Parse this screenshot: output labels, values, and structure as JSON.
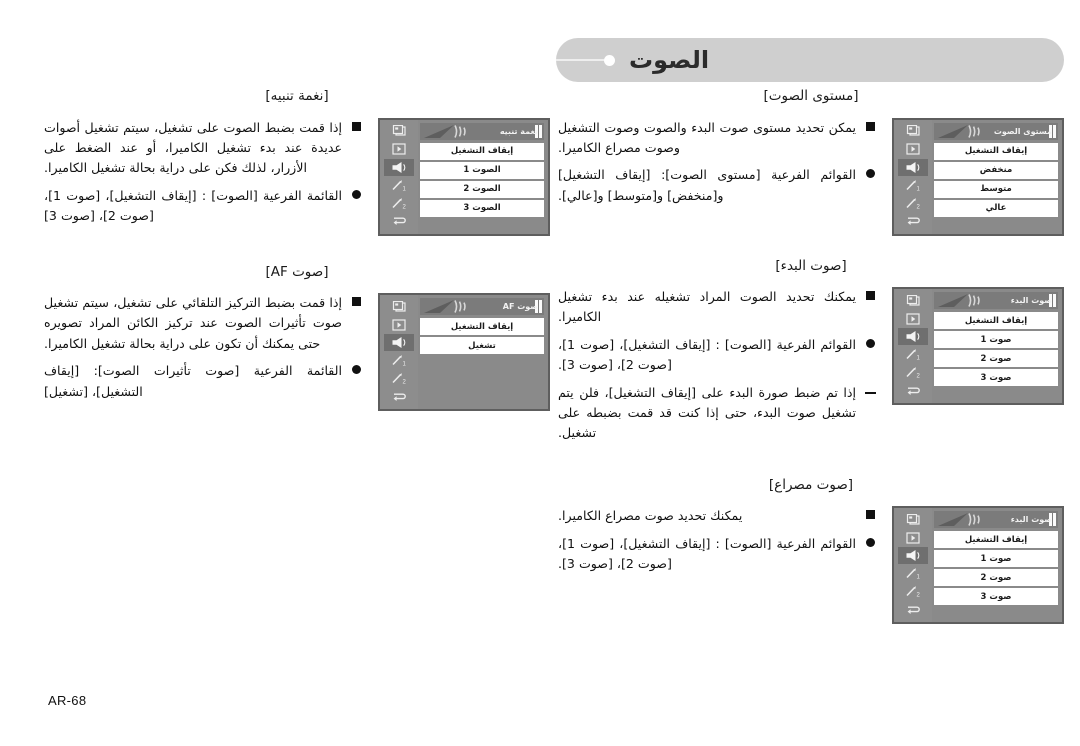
{
  "page": {
    "number_label": "AR-68",
    "header_title": "الصوت"
  },
  "sections": {
    "volume_level": {
      "title": "[مستوى الصوت]",
      "bullets": [
        "يمكن تحديد مستوى صوت البدء والصوت وصوت التشغيل وصوت مصراع الكاميرا.",
        "القوائم الفرعية [مستوى الصوت]: [إيقاف التشغيل] و[منخفض] و[متوسط] و[عالي]."
      ],
      "menu": {
        "header": "مستوى الصوت",
        "items": [
          "إيقاف التشغيل",
          "منخفض",
          "متوسط",
          "عالي"
        ]
      }
    },
    "start_sound": {
      "title": "[صوت البدء]",
      "bullets": [
        "يمكنك تحديد الصوت المراد تشغيله عند بدء تشغيل الكاميرا.",
        "القوائم الفرعية [الصوت] : [إيقاف التشغيل]، [صوت 1]، [صوت 2]، [صوت 3].",
        "إذا تم ضبط صورة البدء على [إيقاف التشغيل]، فلن يتم تشغيل صوت البدء، حتى إذا كنت قد قمت بضبطه على تشغيل."
      ],
      "menu": {
        "header": "صوت البدء",
        "items": [
          "إيقاف التشغيل",
          "صوت 1",
          "صوت 2",
          "صوت 3"
        ]
      }
    },
    "shutter_sound": {
      "title": "[صوت مصراع]",
      "bullets": [
        "يمكنك تحديد صوت مصراع الكاميرا.",
        "القوائم الفرعية [الصوت] : [إيقاف التشغيل]، [صوت 1]، [صوت 2]، [صوت 3]."
      ],
      "menu": {
        "header": "صوت البدء",
        "items": [
          "إيقاف التشغيل",
          "صوت 1",
          "صوت 2",
          "صوت 3"
        ]
      }
    },
    "beep_sound": {
      "title": "[نغمة تنبيه]",
      "bullets": [
        "إذا قمت بضبط الصوت على تشغيل، سيتم تشغيل أصوات عديدة عند بدء تشغيل الكاميرا، أو عند الضغط على الأزرار، لذلك فكن على دراية بحالة تشغيل الكاميرا.",
        "القائمة الفرعية [الصوت] : [إيقاف التشغيل]، [صوت 1]، [صوت 2]، [صوت 3]"
      ],
      "menu": {
        "header": "نغمة تنبيه",
        "items": [
          "إيقاف التشغيل",
          "الصوت 1",
          "الصوت 2",
          "الصوت 3"
        ]
      }
    },
    "af_sound": {
      "title": "[صوت AF]",
      "bullets": [
        "إذا قمت بضبط التركيز التلقائي على تشغيل، سيتم تشغيل صوت تأثيرات الصوت عند تركيز الكائن المراد تصويره حتى يمكنك أن تكون على دراية بحالة تشغيل الكاميرا.",
        "القائمة الفرعية [صوت تأثيرات الصوت]: [إيقاف التشغيل]، [تشغيل]"
      ],
      "menu": {
        "header": "صوت AF",
        "items": [
          "إيقاف التشغيل",
          "تشغيل"
        ]
      }
    }
  },
  "menu_rail_icons": [
    "camera-stack-icon",
    "playback-icon",
    "speaker-icon",
    "setup1-icon",
    "setup2-icon",
    "return-icon"
  ]
}
